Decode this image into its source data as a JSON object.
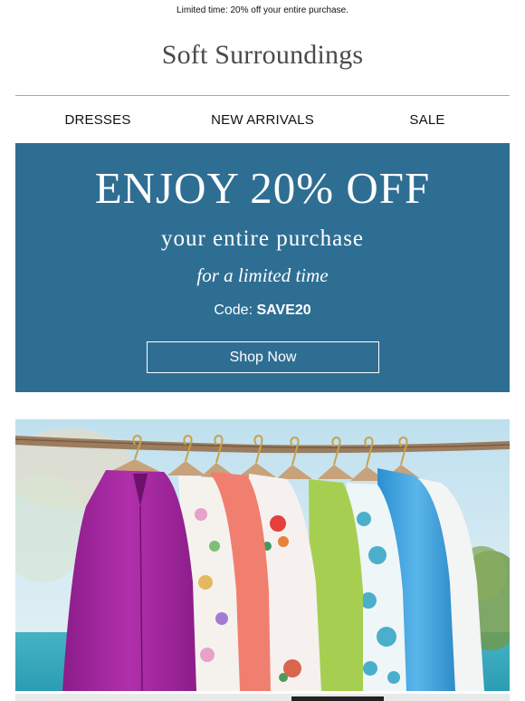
{
  "preheader": {
    "text": "Limited time: 20% off your entire purchase."
  },
  "brand": {
    "logo_text": "Soft Surroundings"
  },
  "nav": {
    "items": [
      {
        "label": "DRESSES"
      },
      {
        "label": "NEW ARRIVALS"
      },
      {
        "label": "SALE"
      }
    ]
  },
  "promo": {
    "headline": "ENJOY 20% OFF",
    "subheadline": "your entire purchase",
    "limited": "for a limited time",
    "code_label": "Code:",
    "code_value": "SAVE20",
    "button_label": "Shop Now",
    "background_color": "#2f6e93"
  },
  "hero": {
    "image_name": "colorful-blouses-on-branch-rack"
  }
}
